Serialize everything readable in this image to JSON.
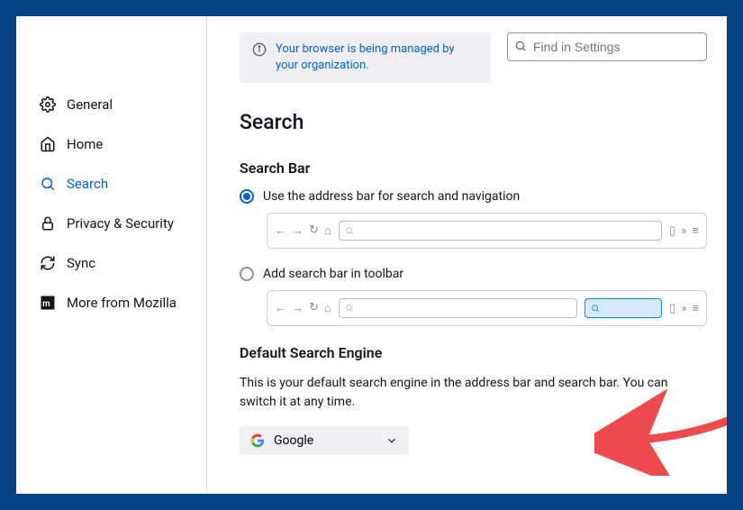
{
  "sidebar": {
    "items": [
      {
        "label": "General"
      },
      {
        "label": "Home"
      },
      {
        "label": "Search"
      },
      {
        "label": "Privacy & Security"
      },
      {
        "label": "Sync"
      },
      {
        "label": "More from Mozilla"
      }
    ]
  },
  "notice": {
    "text": "Your browser is being managed by your organization."
  },
  "search_settings": {
    "placeholder": "Find in Settings"
  },
  "page": {
    "title": "Search",
    "section1_title": "Search Bar",
    "radio1_label": "Use the address bar for search and navigation",
    "radio2_label": "Add search bar in toolbar",
    "section2_title": "Default Search Engine",
    "section2_desc": "This is your default search engine in the address bar and search bar. You can switch it at any time.",
    "dropdown_value": "Google"
  }
}
